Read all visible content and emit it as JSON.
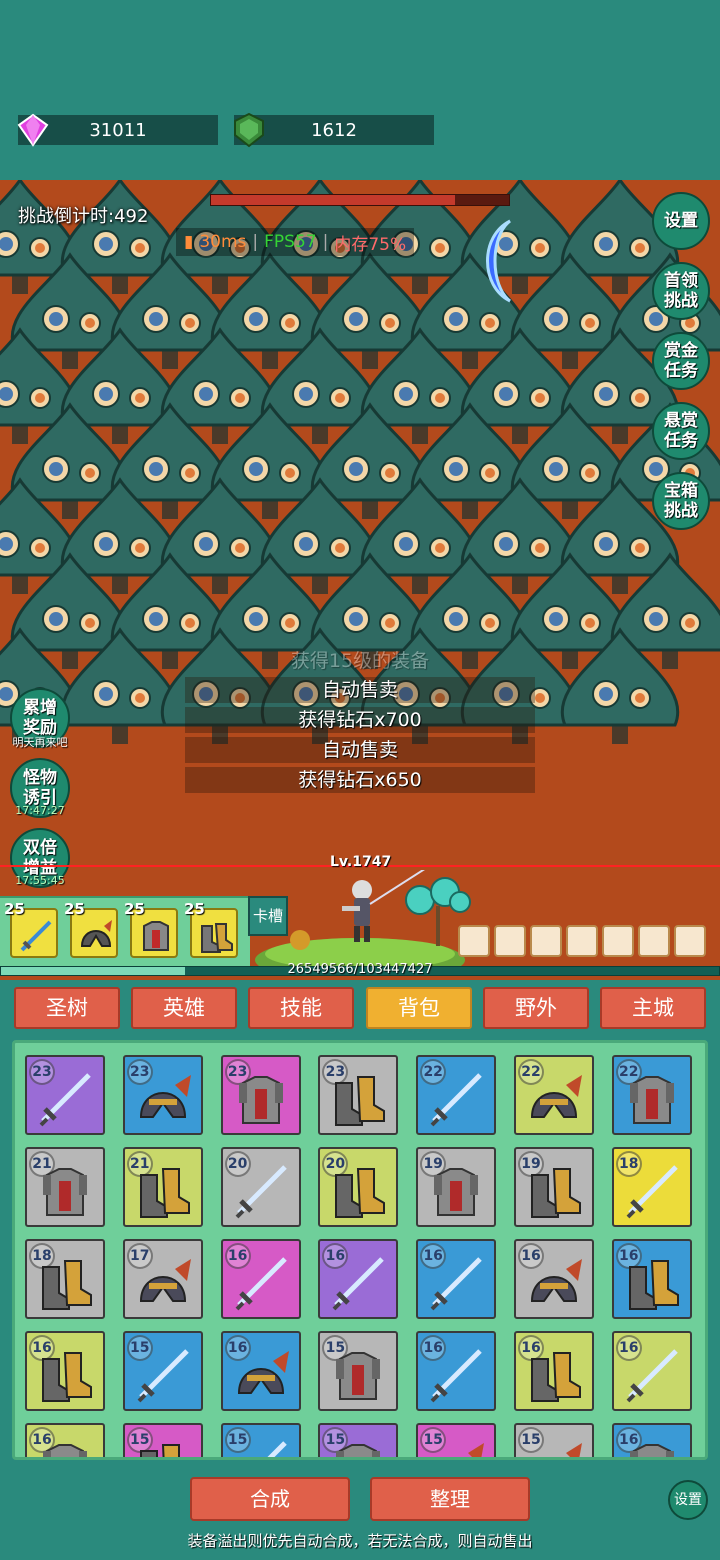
{
  "resources": {
    "gems": "31011",
    "shields": "1612"
  },
  "battle": {
    "timer": "挑战倒计时:492",
    "perf": {
      "ping": "30ms",
      "fps": "FPS57",
      "memory": "内存75%"
    },
    "level": "Lv.1747",
    "exp_text": "26549566/103447427",
    "exp_fraction": 0.2566,
    "boss_hp_fraction": 0.82,
    "log": [
      "获得15级的装备",
      "自动售卖",
      "获得钻石x700",
      "自动售卖",
      "获得钻石x650"
    ],
    "side_buttons": [
      {
        "line1": "设置",
        "line2": ""
      },
      {
        "line1": "首领",
        "line2": "挑战"
      },
      {
        "line1": "赏金",
        "line2": "任务"
      },
      {
        "line1": "悬赏",
        "line2": "任务"
      },
      {
        "line1": "宝箱",
        "line2": "挑战"
      }
    ],
    "left_buttons": [
      {
        "line1": "累增",
        "line2": "奖励",
        "sub": "明天再来吧"
      },
      {
        "line1": "怪物",
        "line2": "诱引",
        "sub": "17:47:27"
      },
      {
        "line1": "双倍",
        "line2": "增益",
        "sub": "17:55:45"
      }
    ]
  },
  "equipped": {
    "slots": [
      {
        "level": "25",
        "type": "sword-icon"
      },
      {
        "level": "25",
        "type": "helmet-icon"
      },
      {
        "level": "25",
        "type": "armor-icon"
      },
      {
        "level": "25",
        "type": "boots-icon"
      }
    ],
    "card_slot_label": "卡槽"
  },
  "tabs": [
    "圣树",
    "英雄",
    "技能",
    "背包",
    "野外",
    "主城"
  ],
  "active_tab": "背包",
  "inventory": [
    {
      "level": "23",
      "color": "purple",
      "type": "sword-icon"
    },
    {
      "level": "23",
      "color": "blue",
      "type": "helmet-icon"
    },
    {
      "level": "23",
      "color": "pink",
      "type": "armor-icon"
    },
    {
      "level": "23",
      "color": "gray",
      "type": "boots-icon"
    },
    {
      "level": "22",
      "color": "blue",
      "type": "sword-icon"
    },
    {
      "level": "22",
      "color": "yellowgreen",
      "type": "helmet-icon"
    },
    {
      "level": "22",
      "color": "blue",
      "type": "armor-icon"
    },
    {
      "level": "21",
      "color": "gray",
      "type": "armor-icon"
    },
    {
      "level": "21",
      "color": "yellowgreen",
      "type": "boots-icon"
    },
    {
      "level": "20",
      "color": "gray",
      "type": "sword-icon"
    },
    {
      "level": "20",
      "color": "yellowgreen",
      "type": "boots-icon"
    },
    {
      "level": "19",
      "color": "gray",
      "type": "armor-icon"
    },
    {
      "level": "19",
      "color": "gray",
      "type": "boots-icon"
    },
    {
      "level": "18",
      "color": "yellow",
      "type": "sword-icon"
    },
    {
      "level": "18",
      "color": "gray",
      "type": "boots-icon"
    },
    {
      "level": "17",
      "color": "gray",
      "type": "helmet-icon"
    },
    {
      "level": "16",
      "color": "pink",
      "type": "sword-icon"
    },
    {
      "level": "16",
      "color": "purple",
      "type": "sword-icon"
    },
    {
      "level": "16",
      "color": "blue",
      "type": "sword-icon"
    },
    {
      "level": "16",
      "color": "gray",
      "type": "helmet-icon"
    },
    {
      "level": "16",
      "color": "blue",
      "type": "boots-icon"
    },
    {
      "level": "16",
      "color": "yellowgreen",
      "type": "boots-icon"
    },
    {
      "level": "15",
      "color": "blue",
      "type": "sword-icon"
    },
    {
      "level": "16",
      "color": "blue",
      "type": "helmet-icon"
    },
    {
      "level": "15",
      "color": "gray",
      "type": "armor-icon"
    },
    {
      "level": "16",
      "color": "blue",
      "type": "sword-icon"
    },
    {
      "level": "16",
      "color": "yellowgreen",
      "type": "boots-icon"
    },
    {
      "level": "16",
      "color": "yellowgreen",
      "type": "sword-icon"
    },
    {
      "level": "16",
      "color": "yellowgreen",
      "type": "armor-icon"
    },
    {
      "level": "15",
      "color": "pink",
      "type": "boots-icon"
    },
    {
      "level": "15",
      "color": "blue",
      "type": "sword-icon"
    },
    {
      "level": "15",
      "color": "purple",
      "type": "armor-icon"
    },
    {
      "level": "15",
      "color": "pink",
      "type": "helmet-icon"
    },
    {
      "level": "15",
      "color": "gray",
      "type": "helmet-icon"
    },
    {
      "level": "16",
      "color": "blue",
      "type": "armor-icon"
    }
  ],
  "buttons": {
    "merge": "合成",
    "sort": "整理",
    "settings": "设置"
  },
  "footer_note": "装备溢出则优先自动合成，若无法合成，则自动售出"
}
